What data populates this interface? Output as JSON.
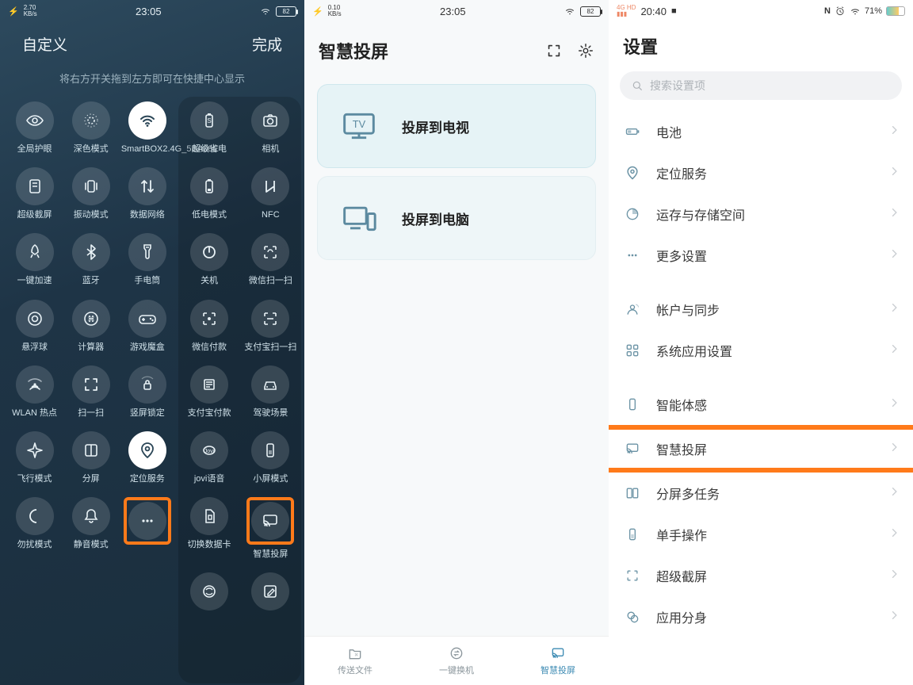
{
  "panel1": {
    "status": {
      "netspeed": "2.70",
      "netunit": "KB/s",
      "time": "23:05",
      "battery": "82"
    },
    "header": {
      "customize": "自定义",
      "done": "完成"
    },
    "hint": "将右方开关拖到左方即可在快捷中心显示",
    "left_items": [
      {
        "icon": "eye",
        "label": "全局护眼"
      },
      {
        "icon": "sun-dim",
        "label": "深色模式"
      },
      {
        "icon": "wifi",
        "label": "SmartBOX2.4G_5BA08E",
        "active": true
      },
      {
        "icon": "screenshot-long",
        "label": "超级截屏"
      },
      {
        "icon": "vibrate",
        "label": "振动模式"
      },
      {
        "icon": "data",
        "label": "数据网络"
      },
      {
        "icon": "rocket",
        "label": "一键加速"
      },
      {
        "icon": "bluetooth",
        "label": "蓝牙"
      },
      {
        "icon": "flashlight",
        "label": "手电筒"
      },
      {
        "icon": "record",
        "label": "悬浮球"
      },
      {
        "icon": "calc",
        "label": "计算器"
      },
      {
        "icon": "gamebox",
        "label": "游戏魔盒"
      },
      {
        "icon": "hotspot",
        "label": "WLAN 热点"
      },
      {
        "icon": "scan-sq",
        "label": "扫一扫"
      },
      {
        "icon": "lock-rotate",
        "label": "竖屏锁定"
      },
      {
        "icon": "airplane",
        "label": "飞行模式"
      },
      {
        "icon": "split",
        "label": "分屏"
      },
      {
        "icon": "location",
        "label": "定位服务",
        "active": true
      },
      {
        "icon": "moon",
        "label": "勿扰模式"
      },
      {
        "icon": "bell",
        "label": "静音模式"
      },
      {
        "icon": "more",
        "label": "",
        "highlight": true
      }
    ],
    "right_items": [
      {
        "icon": "battery-s",
        "label": "超级省电"
      },
      {
        "icon": "camera",
        "label": "相机"
      },
      {
        "icon": "battery-low",
        "label": "低电模式"
      },
      {
        "icon": "nfc",
        "label": "NFC"
      },
      {
        "icon": "power",
        "label": "关机"
      },
      {
        "icon": "wechat-scan",
        "label": "微信扫一扫"
      },
      {
        "icon": "wechat-pay",
        "label": "微信付款"
      },
      {
        "icon": "alipay-scan",
        "label": "支付宝扫一扫"
      },
      {
        "icon": "alipay-code",
        "label": "支付宝付款"
      },
      {
        "icon": "car",
        "label": "驾驶场景"
      },
      {
        "icon": "jovi",
        "label": "jovi语音"
      },
      {
        "icon": "miniwindow",
        "label": "小屏模式"
      },
      {
        "icon": "sim",
        "label": "切换数据卡"
      },
      {
        "icon": "cast",
        "label": "智慧投屏",
        "highlight": true
      },
      {
        "icon": "lens",
        "label": ""
      },
      {
        "icon": "edit",
        "label": ""
      }
    ]
  },
  "panel2": {
    "status": {
      "netspeed": "0.10",
      "netunit": "KB/s",
      "time": "23:05",
      "battery": "82"
    },
    "title": "智慧投屏",
    "cards": [
      {
        "icon": "tv",
        "label": "投屏到电视"
      },
      {
        "icon": "pc",
        "label": "投屏到电脑"
      }
    ],
    "nav": [
      {
        "icon": "folder",
        "label": "传送文件"
      },
      {
        "icon": "swap",
        "label": "一键换机"
      },
      {
        "icon": "cast",
        "label": "智慧投屏",
        "active": true
      }
    ]
  },
  "panel3": {
    "status": {
      "signal": "4G HD",
      "time": "20:40",
      "battery_pct": "71%"
    },
    "title": "设置",
    "search_placeholder": "搜索设置项",
    "groups": [
      [
        {
          "icon": "battery",
          "label": "电池",
          "color": "grey"
        },
        {
          "icon": "location",
          "label": "定位服务",
          "color": "orange"
        },
        {
          "icon": "storage",
          "label": "运存与存储空间",
          "color": "grey"
        },
        {
          "icon": "more",
          "label": "更多设置",
          "color": "grey"
        }
      ],
      [
        {
          "icon": "account",
          "label": "帐户与同步",
          "color": "grey"
        },
        {
          "icon": "apps",
          "label": "系统应用设置",
          "color": "grey"
        }
      ],
      [
        {
          "icon": "motion",
          "label": "智能体感",
          "color": "grey"
        },
        {
          "icon": "cast",
          "label": "智慧投屏",
          "color": "teal",
          "highlight": true
        },
        {
          "icon": "multiwin",
          "label": "分屏多任务",
          "color": "orange"
        },
        {
          "icon": "onehand",
          "label": "单手操作",
          "color": "grey"
        },
        {
          "icon": "screenshot",
          "label": "超级截屏",
          "color": "teal"
        },
        {
          "icon": "clone",
          "label": "应用分身",
          "color": "grey"
        }
      ]
    ]
  }
}
